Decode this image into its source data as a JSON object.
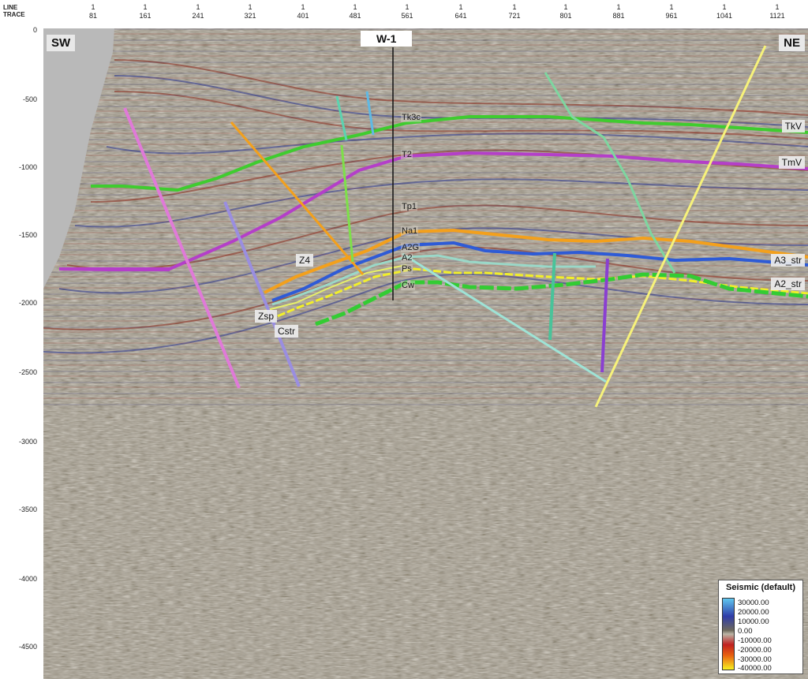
{
  "header": {
    "line_label": "LINE",
    "trace_label": "TRACE",
    "columns": [
      {
        "line": "1",
        "trace": "81"
      },
      {
        "line": "1",
        "trace": "161"
      },
      {
        "line": "1",
        "trace": "241"
      },
      {
        "line": "1",
        "trace": "321"
      },
      {
        "line": "1",
        "trace": "401"
      },
      {
        "line": "1",
        "trace": "481"
      },
      {
        "line": "1",
        "trace": "561"
      },
      {
        "line": "1",
        "trace": "641"
      },
      {
        "line": "1",
        "trace": "721"
      },
      {
        "line": "1",
        "trace": "801"
      },
      {
        "line": "1",
        "trace": "881"
      },
      {
        "line": "1",
        "trace": "961"
      },
      {
        "line": "1",
        "trace": "1041"
      },
      {
        "line": "1",
        "trace": "1121"
      }
    ]
  },
  "y_axis": {
    "ticks": [
      "0",
      "-500",
      "-1000",
      "-1500",
      "-2000",
      "-2500",
      "-3000",
      "-3500",
      "-4000",
      "-4500"
    ]
  },
  "section": {
    "left_label": "SW",
    "right_label": "NE",
    "well_name": "W-1"
  },
  "horizon_labels": {
    "tkv": "TkV",
    "tmv": "TmV",
    "a3_str": "A3_str",
    "a2_str": "A2_str",
    "z4": "Z4",
    "zsp": "Zsp",
    "cstr": "Cstr"
  },
  "well_tops": [
    "Tk3c",
    "T2",
    "Tp1",
    "Na1",
    "A2G",
    "A2",
    "Ps",
    "Cw"
  ],
  "legend": {
    "title": "Seismic (default)",
    "values": [
      "30000.00",
      "20000.00",
      "10000.00",
      "0.00",
      "-10000.00",
      "-20000.00",
      "-30000.00",
      "-40000.00"
    ]
  },
  "colors": {
    "tkv_horizon": "#3fcc2f",
    "tmv_horizon": "#b43fc9",
    "na1_horizon": "#f3a01c",
    "a3_horizon": "#2e5bd6",
    "a2_horizon": "#f2ef2a",
    "cw_horizon": "#33cc33"
  }
}
